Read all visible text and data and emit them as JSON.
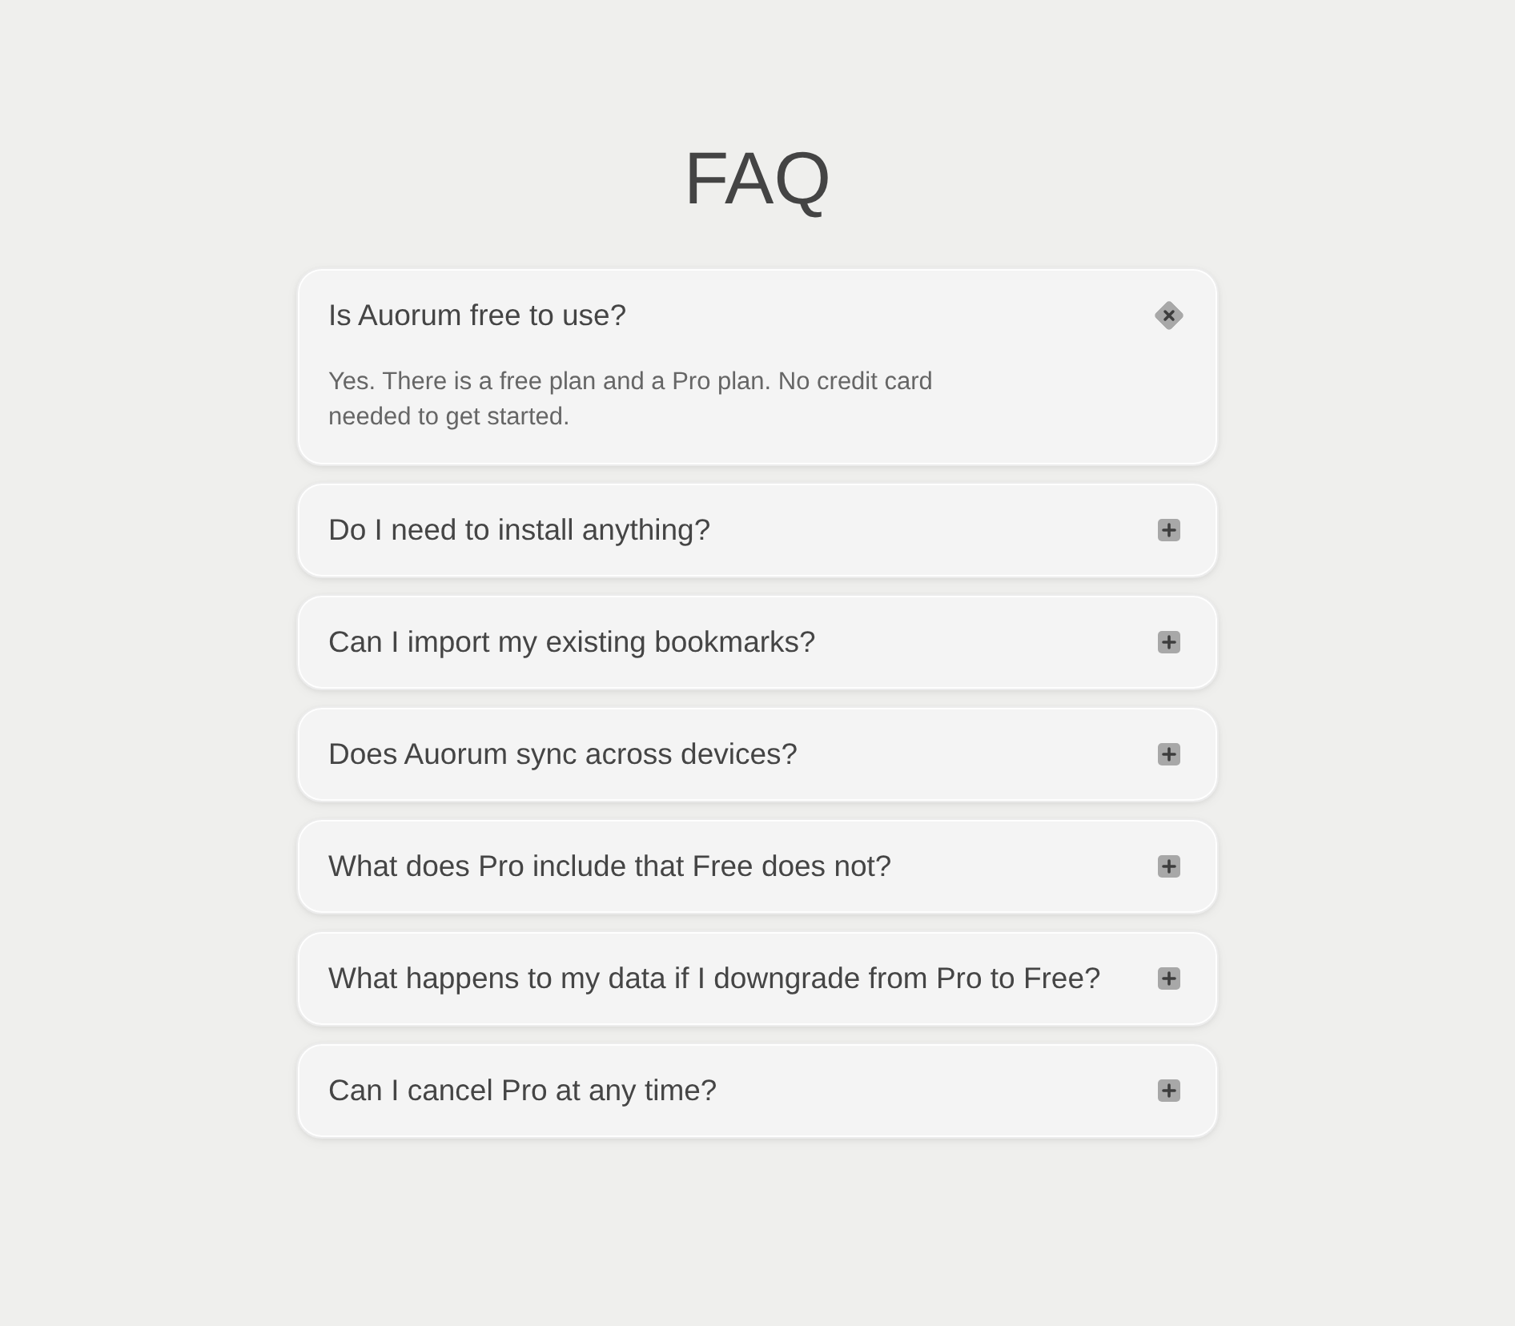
{
  "title": "FAQ",
  "items": [
    {
      "question": "Is Auorum free to use?",
      "expanded": true,
      "answer": "Yes. There is a free plan and a Pro plan. No credit card needed to get started."
    },
    {
      "question": "Do I need to install anything?",
      "expanded": false
    },
    {
      "question": "Can I import my existing bookmarks?",
      "expanded": false
    },
    {
      "question": "Does Auorum sync across devices?",
      "expanded": false
    },
    {
      "question": "What does Pro include that Free does not?",
      "expanded": false
    },
    {
      "question": "What happens to my data if I downgrade from Pro to Free?",
      "expanded": false
    },
    {
      "question": "Can I cancel Pro at any time?",
      "expanded": false
    }
  ]
}
